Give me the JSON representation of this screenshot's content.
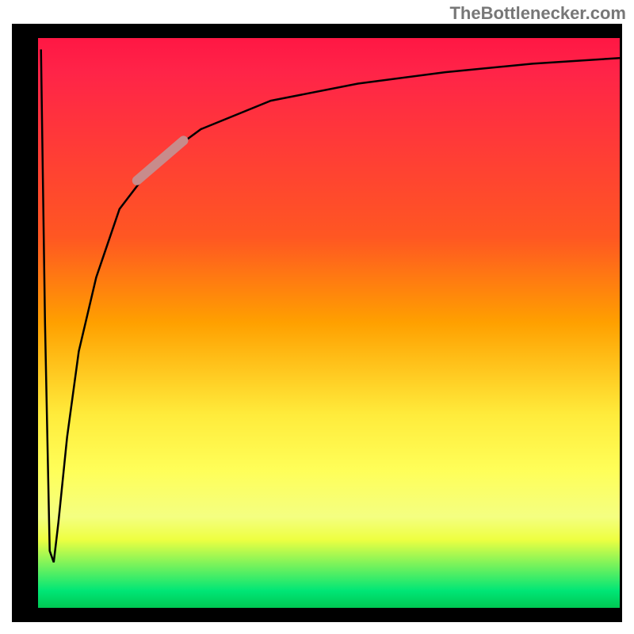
{
  "attribution": "TheBottlenecker.com",
  "chart_data": {
    "type": "line",
    "title": "",
    "xlabel": "",
    "ylabel": "",
    "xlim": [
      0,
      100
    ],
    "ylim": [
      0,
      100
    ],
    "series": [
      {
        "name": "curve",
        "x": [
          0.5,
          1.2,
          2.0,
          2.7,
          3.5,
          5,
          7,
          10,
          14,
          20,
          28,
          40,
          55,
          70,
          85,
          100
        ],
        "y": [
          98,
          50,
          10,
          8,
          15,
          30,
          45,
          58,
          70,
          78,
          84,
          89,
          92,
          94,
          95.5,
          96.5
        ]
      }
    ],
    "highlight_segment": {
      "x_start": 17,
      "x_end": 25,
      "y_start": 75,
      "y_end": 82
    },
    "colors": {
      "gradient_top": "#ff1744",
      "gradient_mid": "#ffeb3b",
      "gradient_bottom": "#00c853",
      "frame": "#000000",
      "highlight": "#c88b8b"
    }
  }
}
